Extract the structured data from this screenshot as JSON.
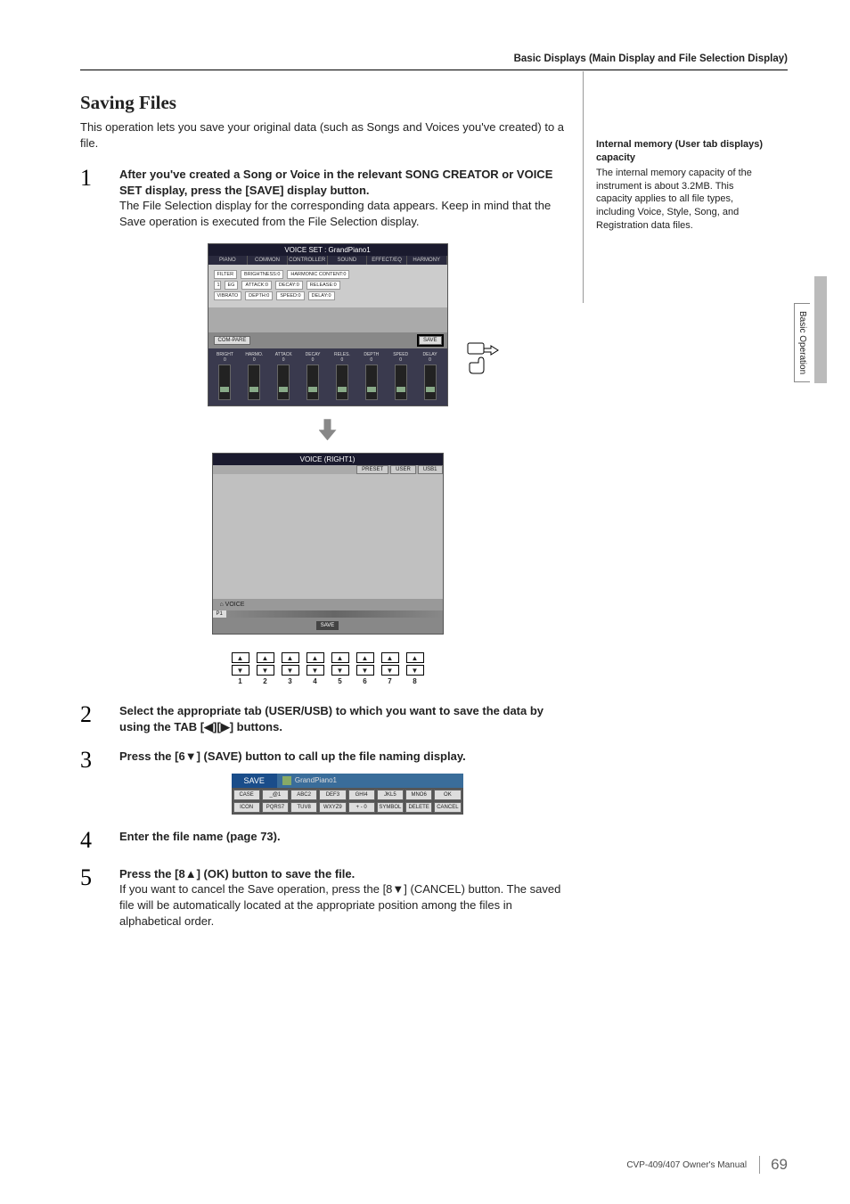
{
  "header": {
    "title": "Basic Displays (Main Display and File Selection Display)"
  },
  "section": {
    "title": "Saving Files",
    "intro": "This operation lets you save your original data (such as Songs and Voices you've created) to a file."
  },
  "sideNote": {
    "title": "Internal memory (User tab displays) capacity",
    "body": "The internal memory capacity of the instrument is about 3.2MB. This capacity applies to all file types, including Voice, Style, Song, and Registration data files."
  },
  "steps": [
    {
      "num": "1",
      "bold": "After you've created a Song or Voice in the relevant SONG CREATOR or VOICE SET display, press the [SAVE] display button.",
      "text": "The File Selection display for the corresponding data appears. Keep in mind that the Save operation is executed from the File Selection display."
    },
    {
      "num": "2",
      "bold": "Select the appropriate tab (USER/USB) to which you want to save the data by using the TAB [◀][▶] buttons.",
      "text": ""
    },
    {
      "num": "3",
      "bold": "Press the [6▼] (SAVE) button to call up the file naming display.",
      "text": ""
    },
    {
      "num": "4",
      "bold": "Enter the file name (page 73).",
      "text": ""
    },
    {
      "num": "5",
      "bold": "Press the [8▲] (OK) button to save the file.",
      "text": "If you want to cancel the Save operation, press the [8▼] (CANCEL) button. The saved file will be automatically located at the appropriate position among the files in alphabetical order."
    }
  ],
  "voiceSet": {
    "title": "VOICE SET : GrandPiano1",
    "tabs": [
      "PIANO",
      "COMMON",
      "CONTROLLER",
      "SOUND",
      "EFFECT/EQ",
      "HARMONY"
    ],
    "rows": {
      "r1": [
        "FILTER",
        "BRIGHTNESS:0",
        "HARMONIC CONTENT:0"
      ],
      "r2a": "1",
      "r2": [
        "EG",
        "ATTACK:0",
        "DECAY:0",
        "RELEASE:0"
      ],
      "r3": [
        "VIBRATO",
        "DEPTH:0",
        "SPEED:0",
        "DELAY:0"
      ]
    },
    "compare": "COM-PARE",
    "save": "SAVE",
    "sliderGroups": [
      "FILTER",
      "EG",
      "VIBRATO"
    ],
    "sliders": [
      "BRIGHT",
      "HARMO.",
      "ATTACK",
      "DECAY",
      "RELES.",
      "DEPTH",
      "SPEED",
      "DELAY"
    ],
    "sliderVal": "0"
  },
  "voiceRight": {
    "title": "VOICE (RIGHT1)",
    "tabs": [
      "PRESET",
      "USER",
      "USB1"
    ],
    "voiceLabel": "⌂ VOICE",
    "p1": "P1",
    "save": "SAVE"
  },
  "buttonRow": {
    "nums": [
      "1",
      "2",
      "3",
      "4",
      "5",
      "6",
      "7",
      "8"
    ],
    "up": "▲",
    "down": "▼"
  },
  "saveEntry": {
    "label": "SAVE",
    "field": "GrandPiano1",
    "keys": [
      "CASE",
      "_@1",
      "ABC2",
      "DEF3",
      "GHI4",
      "JKL5",
      "MNO6",
      "OK",
      "ICON",
      "PQRS7",
      "TUV8",
      "WXYZ9",
      "+ - 0",
      "SYMBOL",
      "DELETE",
      "CANCEL"
    ]
  },
  "sideTab": "Basic Operation",
  "footer": {
    "text": "CVP-409/407 Owner's Manual",
    "page": "69"
  }
}
